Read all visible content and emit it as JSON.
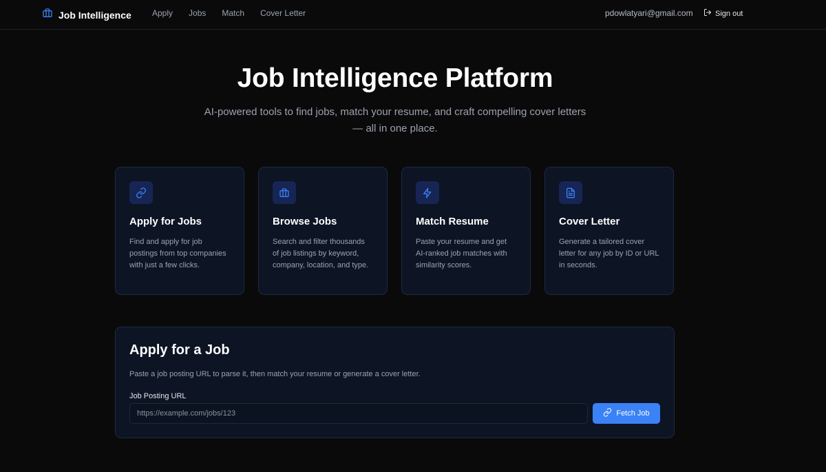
{
  "header": {
    "brand": "Job Intelligence",
    "nav": [
      "Apply",
      "Jobs",
      "Match",
      "Cover Letter"
    ],
    "user_email": "pdowlatyari@gmail.com",
    "signout_label": "Sign out"
  },
  "hero": {
    "title": "Job Intelligence Platform",
    "subtitle": "AI-powered tools to find jobs, match your resume, and craft compelling cover letters — all in one place."
  },
  "features": [
    {
      "icon": "link-icon",
      "title": "Apply for Jobs",
      "description": "Find and apply for job postings from top companies with just a few clicks."
    },
    {
      "icon": "briefcase-icon",
      "title": "Browse Jobs",
      "description": "Search and filter thousands of job listings by keyword, company, location, and type."
    },
    {
      "icon": "lightning-icon",
      "title": "Match Resume",
      "description": "Paste your resume and get AI-ranked job matches with similarity scores."
    },
    {
      "icon": "document-icon",
      "title": "Cover Letter",
      "description": "Generate a tailored cover letter for any job by ID or URL in seconds."
    }
  ],
  "apply": {
    "title": "Apply for a Job",
    "description": "Paste a job posting URL to parse it, then match your resume or generate a cover letter.",
    "field_label": "Job Posting URL",
    "url_placeholder": "https://example.com/jobs/123",
    "url_value": "",
    "button_label": "Fetch Job"
  },
  "colors": {
    "background": "#0a0a0a",
    "card": "#0d1424",
    "accent": "#3b82f6"
  }
}
